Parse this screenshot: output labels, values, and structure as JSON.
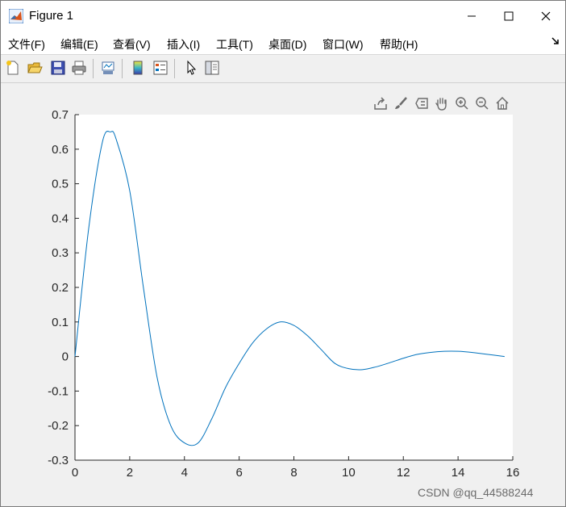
{
  "window": {
    "title": "Figure 1"
  },
  "menu": [
    {
      "label": "文件(F)"
    },
    {
      "label": "编辑(E)"
    },
    {
      "label": "查看(V)"
    },
    {
      "label": "插入(I)"
    },
    {
      "label": "工具(T)"
    },
    {
      "label": "桌面(D)"
    },
    {
      "label": "窗口(W)"
    },
    {
      "label": "帮助(H)"
    }
  ],
  "menu_extra_icon": "dock-arrow-icon",
  "toolbar_icons": [
    "new-figure-icon",
    "open-file-icon",
    "save-icon",
    "print-icon",
    "link-plot-icon",
    "insert-colorbar-icon",
    "insert-legend-icon",
    "edit-plot-cursor-icon",
    "property-editor-icon"
  ],
  "axes_toolbar_icons": [
    "export-icon",
    "brush-icon",
    "data-tips-icon",
    "pan-icon",
    "zoom-in-icon",
    "zoom-out-icon",
    "home-icon"
  ],
  "watermark": "CSDN @qq_44588244",
  "colors": {
    "line": "#0072bd",
    "figure_bg": "#f0f0f0",
    "axes_bg": "#ffffff"
  },
  "chart_data": {
    "type": "line",
    "title": "",
    "xlabel": "",
    "ylabel": "",
    "xlim": [
      0,
      16
    ],
    "ylim": [
      -0.3,
      0.7
    ],
    "xticks": [
      0,
      2,
      4,
      6,
      8,
      10,
      12,
      14,
      16
    ],
    "yticks": [
      -0.3,
      -0.2,
      -0.1,
      0,
      0.1,
      0.2,
      0.3,
      0.4,
      0.5,
      0.6,
      0.7
    ],
    "xtick_labels": [
      "0",
      "2",
      "4",
      "6",
      "8",
      "10",
      "12",
      "14",
      "16"
    ],
    "ytick_labels": [
      "-0.3",
      "-0.2",
      "-0.1",
      "0",
      "0.1",
      "0.2",
      "0.3",
      "0.4",
      "0.5",
      "0.6",
      "0.7"
    ],
    "grid": false,
    "series": [
      {
        "color": "#0072bd",
        "x": [
          0,
          0.5,
          1.0,
          1.3,
          1.5,
          2.0,
          2.5,
          3.0,
          3.5,
          4.0,
          4.5,
          5.0,
          5.5,
          6.0,
          6.5,
          7.0,
          7.5,
          8.0,
          8.5,
          9.0,
          9.5,
          10.0,
          10.5,
          11.0,
          11.5,
          12.0,
          12.5,
          13.0,
          13.5,
          14.0,
          14.5,
          15.0,
          15.7
        ],
        "y": [
          0,
          0.37,
          0.62,
          0.65,
          0.63,
          0.48,
          0.2,
          -0.06,
          -0.2,
          -0.25,
          -0.25,
          -0.18,
          -0.09,
          -0.02,
          0.04,
          0.08,
          0.1,
          0.09,
          0.06,
          0.02,
          -0.02,
          -0.035,
          -0.038,
          -0.03,
          -0.018,
          -0.005,
          0.006,
          0.012,
          0.015,
          0.015,
          0.012,
          0.007,
          0.0
        ]
      }
    ]
  }
}
